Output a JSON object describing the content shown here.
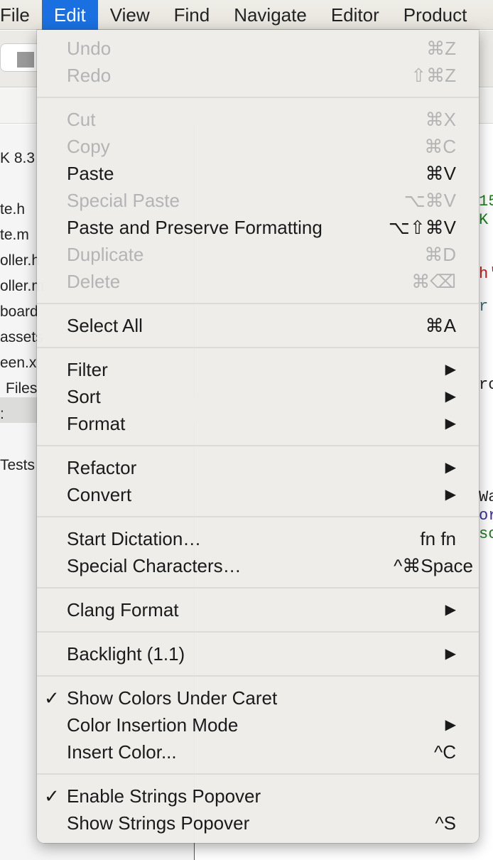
{
  "menubar": {
    "items": [
      "File",
      "Edit",
      "View",
      "Find",
      "Navigate",
      "Editor",
      "Product"
    ],
    "active": "Edit"
  },
  "sidebar": {
    "items": [
      "K 8.3",
      "te.h",
      "te.m",
      "oller.h",
      "oller.m",
      "board",
      "assets",
      "een.x",
      "Files",
      ":",
      "Tests"
    ]
  },
  "editor": {
    "lines": [
      {
        "text": "15",
        "color": "#1c7d1c"
      },
      {
        "text": " K",
        "color": "#1c7d1c"
      },
      {
        "text": "h'",
        "color": "#c41a16"
      },
      {
        "text": "r",
        "color": "#3f6e74"
      },
      {
        "text": "ro",
        "color": "#222222"
      },
      {
        "text": "Wa",
        "color": "#222222"
      },
      {
        "text": "or",
        "color": "#3a2ea0"
      },
      {
        "text": "sc",
        "color": "#1c7d1c"
      }
    ]
  },
  "menu": {
    "groups": [
      [
        {
          "label": "Undo",
          "shortcut": "⌘Z",
          "enabled": false
        },
        {
          "label": "Redo",
          "shortcut": "⇧⌘Z",
          "enabled": false
        }
      ],
      [
        {
          "label": "Cut",
          "shortcut": "⌘X",
          "enabled": false
        },
        {
          "label": "Copy",
          "shortcut": "⌘C",
          "enabled": false
        },
        {
          "label": "Paste",
          "shortcut": "⌘V",
          "enabled": true
        },
        {
          "label": "Special Paste",
          "shortcut": "⌥⌘V",
          "enabled": false
        },
        {
          "label": "Paste and Preserve Formatting",
          "shortcut": "⌥⇧⌘V",
          "enabled": true
        },
        {
          "label": "Duplicate",
          "shortcut": "⌘D",
          "enabled": false
        },
        {
          "label": "Delete",
          "shortcut": "⌘⌫",
          "enabled": false
        }
      ],
      [
        {
          "label": "Select All",
          "shortcut": "⌘A",
          "enabled": true
        }
      ],
      [
        {
          "label": "Filter",
          "submenu": true,
          "enabled": true
        },
        {
          "label": "Sort",
          "submenu": true,
          "enabled": true
        },
        {
          "label": "Format",
          "submenu": true,
          "enabled": true
        }
      ],
      [
        {
          "label": "Refactor",
          "submenu": true,
          "enabled": true
        },
        {
          "label": "Convert",
          "submenu": true,
          "enabled": true
        }
      ],
      [
        {
          "label": "Start Dictation…",
          "shortcut": "fn fn",
          "enabled": true
        },
        {
          "label": "Special Characters…",
          "shortcut": "^⌘Space",
          "enabled": true,
          "wide": true
        }
      ],
      [
        {
          "label": "Clang Format",
          "submenu": true,
          "enabled": true
        }
      ],
      [
        {
          "label": "Backlight (1.1)",
          "submenu": true,
          "enabled": true
        }
      ],
      [
        {
          "label": "Show Colors Under Caret",
          "checked": true,
          "enabled": true
        },
        {
          "label": "Color Insertion Mode",
          "submenu": true,
          "enabled": true
        },
        {
          "label": "Insert Color...",
          "shortcut": "^C",
          "enabled": true
        }
      ],
      [
        {
          "label": "Enable Strings Popover",
          "checked": true,
          "enabled": true
        },
        {
          "label": "Show Strings Popover",
          "shortcut": "^S",
          "enabled": true
        }
      ]
    ]
  },
  "icons": {
    "check": "✓",
    "submenu_arrow": "▶"
  }
}
